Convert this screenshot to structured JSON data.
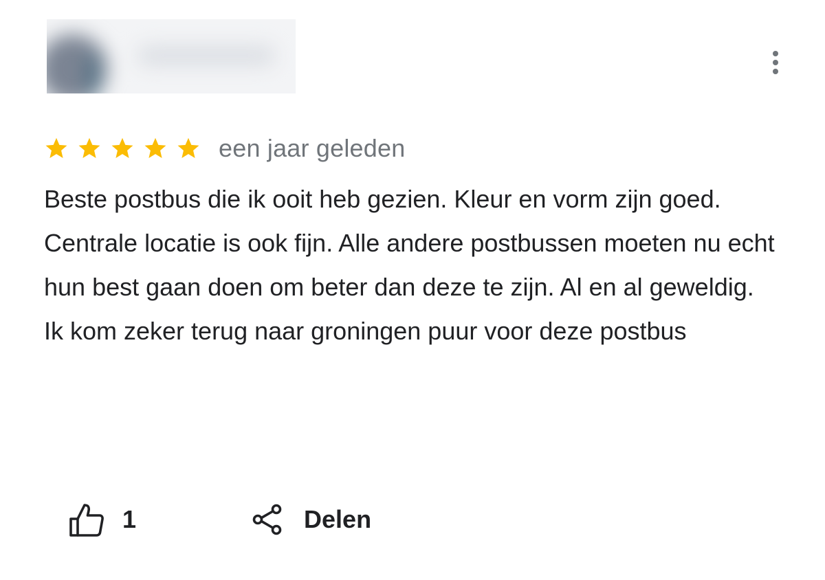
{
  "reviewer": {
    "name": "",
    "avatar_color": "#7b8493",
    "blurred": true
  },
  "menu": {
    "icon": "more-vert-icon"
  },
  "rating": {
    "stars": 5,
    "max_stars": 5,
    "star_color": "#fbbc04",
    "date": "een jaar geleden"
  },
  "review": {
    "text": "Beste postbus die ik ooit heb gezien. Kleur en vorm zijn goed. Centrale locatie is ook fijn. Alle andere postbussen moeten nu echt hun best gaan doen om beter dan deze te zijn. Al en al geweldig.\nIk kom zeker terug naar groningen puur voor deze postbus"
  },
  "actions": {
    "like_icon": "thumb-up-icon",
    "like_count": "1",
    "share_icon": "share-icon",
    "share_label": "Delen"
  },
  "colors": {
    "text": "#202124",
    "secondary_text": "#70757a"
  }
}
